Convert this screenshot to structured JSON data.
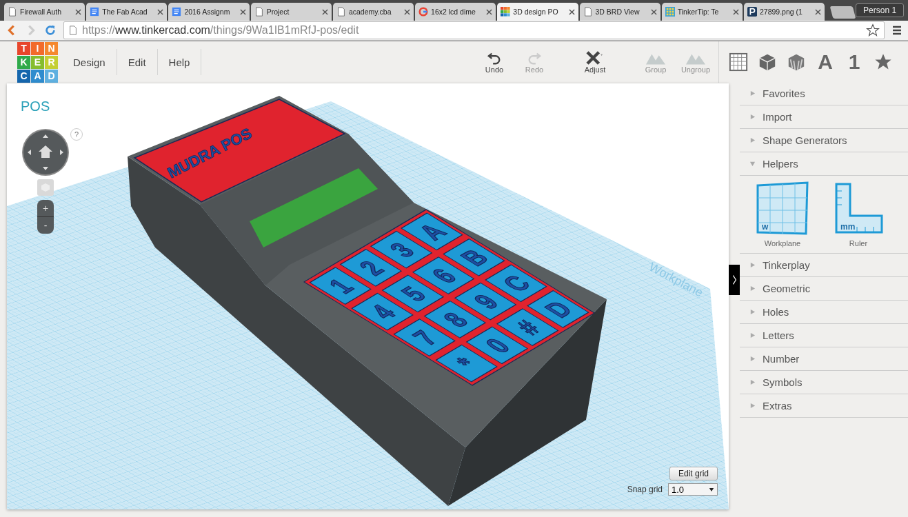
{
  "browser": {
    "tabs": [
      {
        "title": "Firewall Auth",
        "kind": "page",
        "selected": false
      },
      {
        "title": "The Fab Acad",
        "kind": "docs",
        "selected": false
      },
      {
        "title": "2016 Assignm",
        "kind": "docs",
        "selected": false
      },
      {
        "title": "Project",
        "kind": "page",
        "selected": false
      },
      {
        "title": "academy.cba",
        "kind": "page",
        "selected": false
      },
      {
        "title": "16x2 lcd dime",
        "kind": "google",
        "selected": false
      },
      {
        "title": "3D design PO",
        "kind": "tinkercad",
        "selected": true
      },
      {
        "title": "3D BRD View",
        "kind": "page",
        "selected": false
      },
      {
        "title": "TinkerTip: Te",
        "kind": "tiles",
        "selected": false
      },
      {
        "title": "27899.png (1",
        "kind": "letter",
        "selected": false
      }
    ],
    "profile": "Person 1",
    "url": {
      "scheme": "https://",
      "host": "www.tinkercad.com",
      "path": "/things/9Wa1IB1mRfJ-pos/edit"
    }
  },
  "app": {
    "logo": [
      "T",
      "I",
      "N",
      "K",
      "E",
      "R",
      "C",
      "A",
      "D"
    ],
    "menu": [
      "Design",
      "Edit",
      "Help"
    ],
    "toolbar": [
      {
        "label": "Undo",
        "kind": "undo",
        "disabled": false
      },
      {
        "label": "Redo",
        "kind": "redo",
        "disabled": true
      },
      {
        "label": "Adjust",
        "kind": "adjust",
        "disabled": false
      },
      {
        "label": "Group",
        "kind": "group",
        "disabled": true
      },
      {
        "label": "Ungroup",
        "kind": "ungroup",
        "disabled": true
      }
    ],
    "view_icons": [
      {
        "kind": "grid"
      },
      {
        "kind": "cube"
      },
      {
        "kind": "striped-cube"
      },
      {
        "kind": "text",
        "label": "A"
      },
      {
        "kind": "text",
        "label": "1"
      },
      {
        "kind": "star"
      }
    ]
  },
  "viewport": {
    "title": "POS",
    "help": "?",
    "zoom_in": "+",
    "zoom_out": "-",
    "model_label": "MUDRA POS",
    "keypad": [
      [
        "1",
        "2",
        "3",
        "A"
      ],
      [
        "4",
        "5",
        "6",
        "B"
      ],
      [
        "7",
        "8",
        "9",
        "C"
      ],
      [
        "*",
        "0",
        "#",
        "D"
      ]
    ],
    "workplane_label": "Workplane",
    "edit_grid": "Edit grid",
    "snap_label": "Snap grid",
    "snap_value": "1.0"
  },
  "sidebar": {
    "items": [
      {
        "label": "Favorites",
        "expanded": false
      },
      {
        "label": "Import",
        "expanded": false
      },
      {
        "label": "Shape Generators",
        "expanded": false
      },
      {
        "label": "Helpers",
        "expanded": true,
        "children": [
          {
            "label": "Workplane",
            "kind": "workplane",
            "mark": "w"
          },
          {
            "label": "Ruler",
            "kind": "ruler",
            "mark": "mm"
          }
        ]
      },
      {
        "label": "Tinkerplay",
        "expanded": false
      },
      {
        "label": "Geometric",
        "expanded": false
      },
      {
        "label": "Holes",
        "expanded": false
      },
      {
        "label": "Letters",
        "expanded": false
      },
      {
        "label": "Number",
        "expanded": false
      },
      {
        "label": "Symbols",
        "expanded": false
      },
      {
        "label": "Extras",
        "expanded": false
      }
    ]
  }
}
